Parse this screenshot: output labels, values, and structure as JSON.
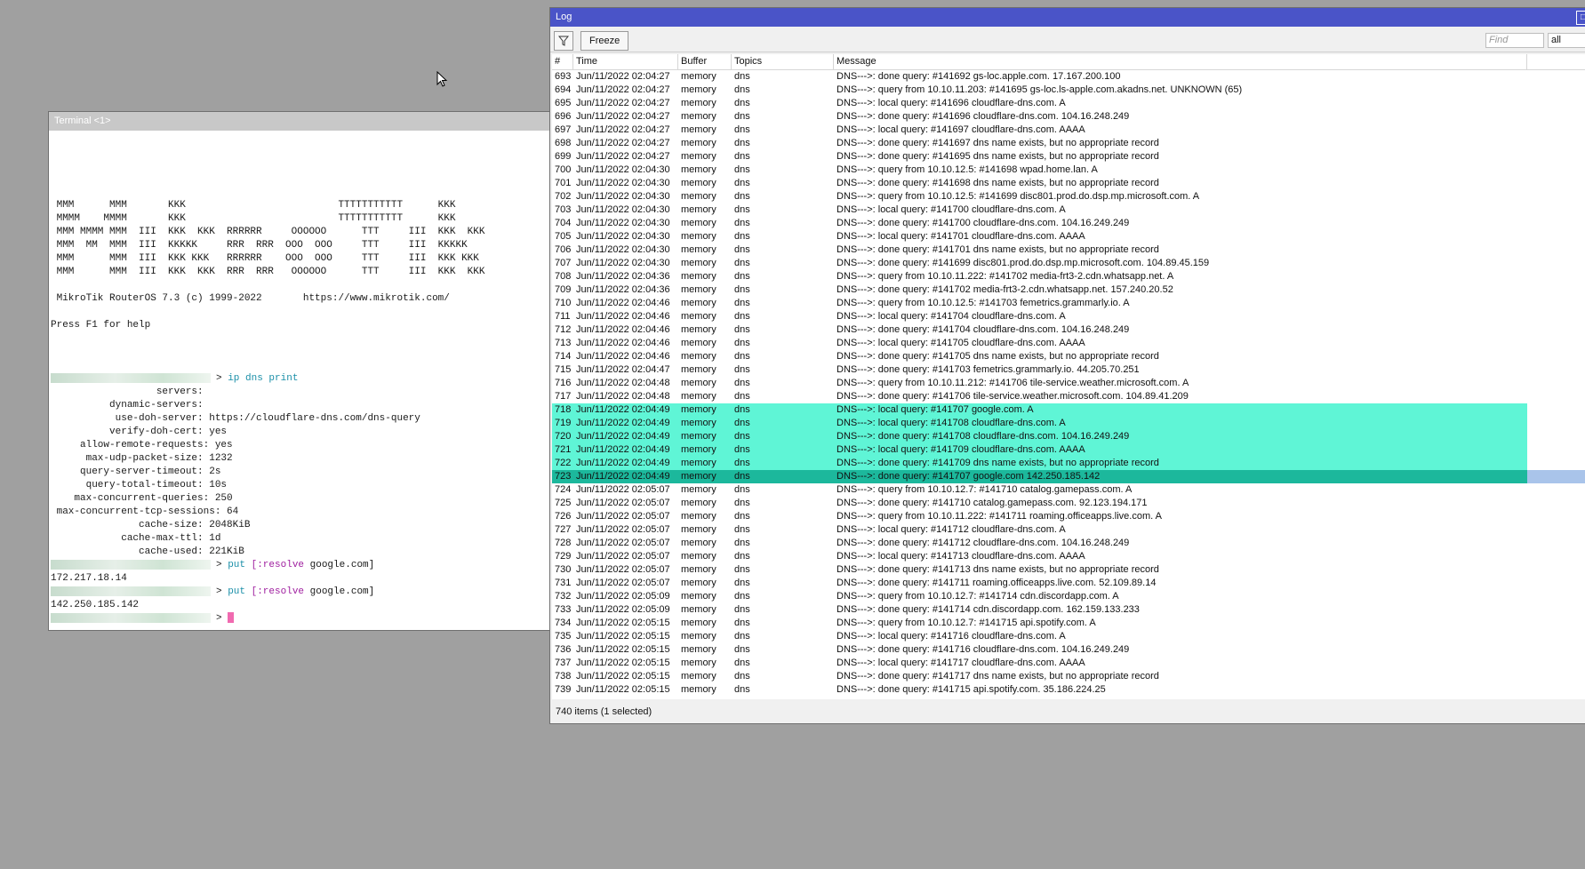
{
  "terminal": {
    "title": "Terminal <1>",
    "banner": [
      "",
      "",
      "",
      "",
      "",
      " MMM      MMM       KKK                          TTTTTTTTTTT      KKK",
      " MMMM    MMMM       KKK                          TTTTTTTTTTT      KKK",
      " MMM MMMM MMM  III  KKK  KKK  RRRRRR     OOOOOO      TTT     III  KKK  KKK",
      " MMM  MM  MMM  III  KKKKK     RRR  RRR  OOO  OOO     TTT     III  KKKKK",
      " MMM      MMM  III  KKK KKK   RRRRRR    OOO  OOO     TTT     III  KKK KKK",
      " MMM      MMM  III  KKK  KKK  RRR  RRR   OOOOOO      TTT     III  KKK  KKK",
      "",
      " MikroTik RouterOS 7.3 (c) 1999-2022       https://www.mikrotik.com/",
      "",
      "Press F1 for help",
      "",
      "",
      ""
    ],
    "cmd1": {
      "arrow": "> ",
      "kw": "ip dns print"
    },
    "settings": [
      "                  servers:",
      "          dynamic-servers:",
      "           use-doh-server: https://cloudflare-dns.com/dns-query",
      "          verify-doh-cert: yes",
      "     allow-remote-requests: yes",
      "      max-udp-packet-size: 1232",
      "     query-server-timeout: 2s",
      "      query-total-timeout: 10s",
      "    max-concurrent-queries: 250",
      " max-concurrent-tcp-sessions: 64",
      "               cache-size: 2048KiB",
      "            cache-max-ttl: 1d",
      "               cache-used: 221KiB"
    ],
    "cmd2": {
      "arrow": "> ",
      "kw": "put ",
      "bracket": "[:resolve",
      "rest": " google.com]"
    },
    "out2": "172.217.18.14",
    "cmd3": {
      "arrow": "> ",
      "kw": "put ",
      "bracket": "[:resolve",
      "rest": " google.com]"
    },
    "out3": "142.250.185.142",
    "cmd4": {
      "arrow": "> "
    }
  },
  "log": {
    "title": "Log",
    "close_icon": "□",
    "freeze_label": "Freeze",
    "find_placeholder": "Find",
    "filter_value": "all",
    "columns": [
      "#",
      "Time",
      "Buffer",
      "Topics",
      "Message"
    ],
    "rows": [
      [
        "693",
        "Jun/11/2022 02:04:27",
        "memory",
        "dns",
        "DNS--->: done query: #141692 gs-loc.apple.com. 17.167.200.100"
      ],
      [
        "694",
        "Jun/11/2022 02:04:27",
        "memory",
        "dns",
        "DNS--->: query from 10.10.11.203: #141695 gs-loc.ls-apple.com.akadns.net. UNKNOWN (65)"
      ],
      [
        "695",
        "Jun/11/2022 02:04:27",
        "memory",
        "dns",
        "DNS--->: local query: #141696 cloudflare-dns.com. A"
      ],
      [
        "696",
        "Jun/11/2022 02:04:27",
        "memory",
        "dns",
        "DNS--->: done query: #141696 cloudflare-dns.com. 104.16.248.249"
      ],
      [
        "697",
        "Jun/11/2022 02:04:27",
        "memory",
        "dns",
        "DNS--->: local query: #141697 cloudflare-dns.com. AAAA"
      ],
      [
        "698",
        "Jun/11/2022 02:04:27",
        "memory",
        "dns",
        "DNS--->: done query: #141697 dns name exists, but no appropriate record"
      ],
      [
        "699",
        "Jun/11/2022 02:04:27",
        "memory",
        "dns",
        "DNS--->: done query: #141695 dns name exists, but no appropriate record"
      ],
      [
        "700",
        "Jun/11/2022 02:04:30",
        "memory",
        "dns",
        "DNS--->: query from 10.10.12.5: #141698 wpad.home.lan. A"
      ],
      [
        "701",
        "Jun/11/2022 02:04:30",
        "memory",
        "dns",
        "DNS--->: done query: #141698 dns name exists, but no appropriate record"
      ],
      [
        "702",
        "Jun/11/2022 02:04:30",
        "memory",
        "dns",
        "DNS--->: query from 10.10.12.5: #141699 disc801.prod.do.dsp.mp.microsoft.com. A"
      ],
      [
        "703",
        "Jun/11/2022 02:04:30",
        "memory",
        "dns",
        "DNS--->: local query: #141700 cloudflare-dns.com. A"
      ],
      [
        "704",
        "Jun/11/2022 02:04:30",
        "memory",
        "dns",
        "DNS--->: done query: #141700 cloudflare-dns.com. 104.16.249.249"
      ],
      [
        "705",
        "Jun/11/2022 02:04:30",
        "memory",
        "dns",
        "DNS--->: local query: #141701 cloudflare-dns.com. AAAA"
      ],
      [
        "706",
        "Jun/11/2022 02:04:30",
        "memory",
        "dns",
        "DNS--->: done query: #141701 dns name exists, but no appropriate record"
      ],
      [
        "707",
        "Jun/11/2022 02:04:30",
        "memory",
        "dns",
        "DNS--->: done query: #141699 disc801.prod.do.dsp.mp.microsoft.com. 104.89.45.159"
      ],
      [
        "708",
        "Jun/11/2022 02:04:36",
        "memory",
        "dns",
        "DNS--->: query from 10.10.11.222: #141702 media-frt3-2.cdn.whatsapp.net. A"
      ],
      [
        "709",
        "Jun/11/2022 02:04:36",
        "memory",
        "dns",
        "DNS--->: done query: #141702 media-frt3-2.cdn.whatsapp.net. 157.240.20.52"
      ],
      [
        "710",
        "Jun/11/2022 02:04:46",
        "memory",
        "dns",
        "DNS--->: query from 10.10.12.5: #141703 femetrics.grammarly.io. A"
      ],
      [
        "711",
        "Jun/11/2022 02:04:46",
        "memory",
        "dns",
        "DNS--->: local query: #141704 cloudflare-dns.com. A"
      ],
      [
        "712",
        "Jun/11/2022 02:04:46",
        "memory",
        "dns",
        "DNS--->: done query: #141704 cloudflare-dns.com. 104.16.248.249"
      ],
      [
        "713",
        "Jun/11/2022 02:04:46",
        "memory",
        "dns",
        "DNS--->: local query: #141705 cloudflare-dns.com. AAAA"
      ],
      [
        "714",
        "Jun/11/2022 02:04:46",
        "memory",
        "dns",
        "DNS--->: done query: #141705 dns name exists, but no appropriate record"
      ],
      [
        "715",
        "Jun/11/2022 02:04:47",
        "memory",
        "dns",
        "DNS--->: done query: #141703 femetrics.grammarly.io. 44.205.70.251"
      ],
      [
        "716",
        "Jun/11/2022 02:04:48",
        "memory",
        "dns",
        "DNS--->: query from 10.10.11.212: #141706 tile-service.weather.microsoft.com. A"
      ],
      [
        "717",
        "Jun/11/2022 02:04:48",
        "memory",
        "dns",
        "DNS--->: done query: #141706 tile-service.weather.microsoft.com. 104.89.41.209"
      ],
      [
        "718",
        "Jun/11/2022 02:04:49",
        "memory",
        "dns",
        "DNS--->: local query: #141707 google.com. A"
      ],
      [
        "719",
        "Jun/11/2022 02:04:49",
        "memory",
        "dns",
        "DNS--->: local query: #141708 cloudflare-dns.com. A"
      ],
      [
        "720",
        "Jun/11/2022 02:04:49",
        "memory",
        "dns",
        "DNS--->: done query: #141708 cloudflare-dns.com. 104.16.249.249"
      ],
      [
        "721",
        "Jun/11/2022 02:04:49",
        "memory",
        "dns",
        "DNS--->: local query: #141709 cloudflare-dns.com. AAAA"
      ],
      [
        "722",
        "Jun/11/2022 02:04:49",
        "memory",
        "dns",
        "DNS--->: done query: #141709 dns name exists, but no appropriate record"
      ],
      [
        "723",
        "Jun/11/2022 02:04:49",
        "memory",
        "dns",
        "DNS--->: done query: #141707 google.com 142.250.185.142"
      ],
      [
        "724",
        "Jun/11/2022 02:05:07",
        "memory",
        "dns",
        "DNS--->: query from 10.10.12.7: #141710 catalog.gamepass.com. A"
      ],
      [
        "725",
        "Jun/11/2022 02:05:07",
        "memory",
        "dns",
        "DNS--->: done query: #141710 catalog.gamepass.com. 92.123.194.171"
      ],
      [
        "726",
        "Jun/11/2022 02:05:07",
        "memory",
        "dns",
        "DNS--->: query from 10.10.11.222: #141711 roaming.officeapps.live.com. A"
      ],
      [
        "727",
        "Jun/11/2022 02:05:07",
        "memory",
        "dns",
        "DNS--->: local query: #141712 cloudflare-dns.com. A"
      ],
      [
        "728",
        "Jun/11/2022 02:05:07",
        "memory",
        "dns",
        "DNS--->: done query: #141712 cloudflare-dns.com. 104.16.248.249"
      ],
      [
        "729",
        "Jun/11/2022 02:05:07",
        "memory",
        "dns",
        "DNS--->: local query: #141713 cloudflare-dns.com. AAAA"
      ],
      [
        "730",
        "Jun/11/2022 02:05:07",
        "memory",
        "dns",
        "DNS--->: done query: #141713 dns name exists, but no appropriate record"
      ],
      [
        "731",
        "Jun/11/2022 02:05:07",
        "memory",
        "dns",
        "DNS--->: done query: #141711 roaming.officeapps.live.com. 52.109.89.14"
      ],
      [
        "732",
        "Jun/11/2022 02:05:09",
        "memory",
        "dns",
        "DNS--->: query from 10.10.12.7: #141714 cdn.discordapp.com. A"
      ],
      [
        "733",
        "Jun/11/2022 02:05:09",
        "memory",
        "dns",
        "DNS--->: done query: #141714 cdn.discordapp.com. 162.159.133.233"
      ],
      [
        "734",
        "Jun/11/2022 02:05:15",
        "memory",
        "dns",
        "DNS--->: query from 10.10.12.7: #141715 api.spotify.com. A"
      ],
      [
        "735",
        "Jun/11/2022 02:05:15",
        "memory",
        "dns",
        "DNS--->: local query: #141716 cloudflare-dns.com. A"
      ],
      [
        "736",
        "Jun/11/2022 02:05:15",
        "memory",
        "dns",
        "DNS--->: done query: #141716 cloudflare-dns.com. 104.16.249.249"
      ],
      [
        "737",
        "Jun/11/2022 02:05:15",
        "memory",
        "dns",
        "DNS--->: local query: #141717 cloudflare-dns.com. AAAA"
      ],
      [
        "738",
        "Jun/11/2022 02:05:15",
        "memory",
        "dns",
        "DNS--->: done query: #141717 dns name exists, but no appropriate record"
      ],
      [
        "739",
        "Jun/11/2022 02:05:15",
        "memory",
        "dns",
        "DNS--->: done query: #141715 api.spotify.com. 35.186.224.25"
      ]
    ],
    "highlighted_rows": [
      "718",
      "719",
      "720",
      "721",
      "722"
    ],
    "selected_row": "723",
    "status": "740 items (1 selected)"
  }
}
